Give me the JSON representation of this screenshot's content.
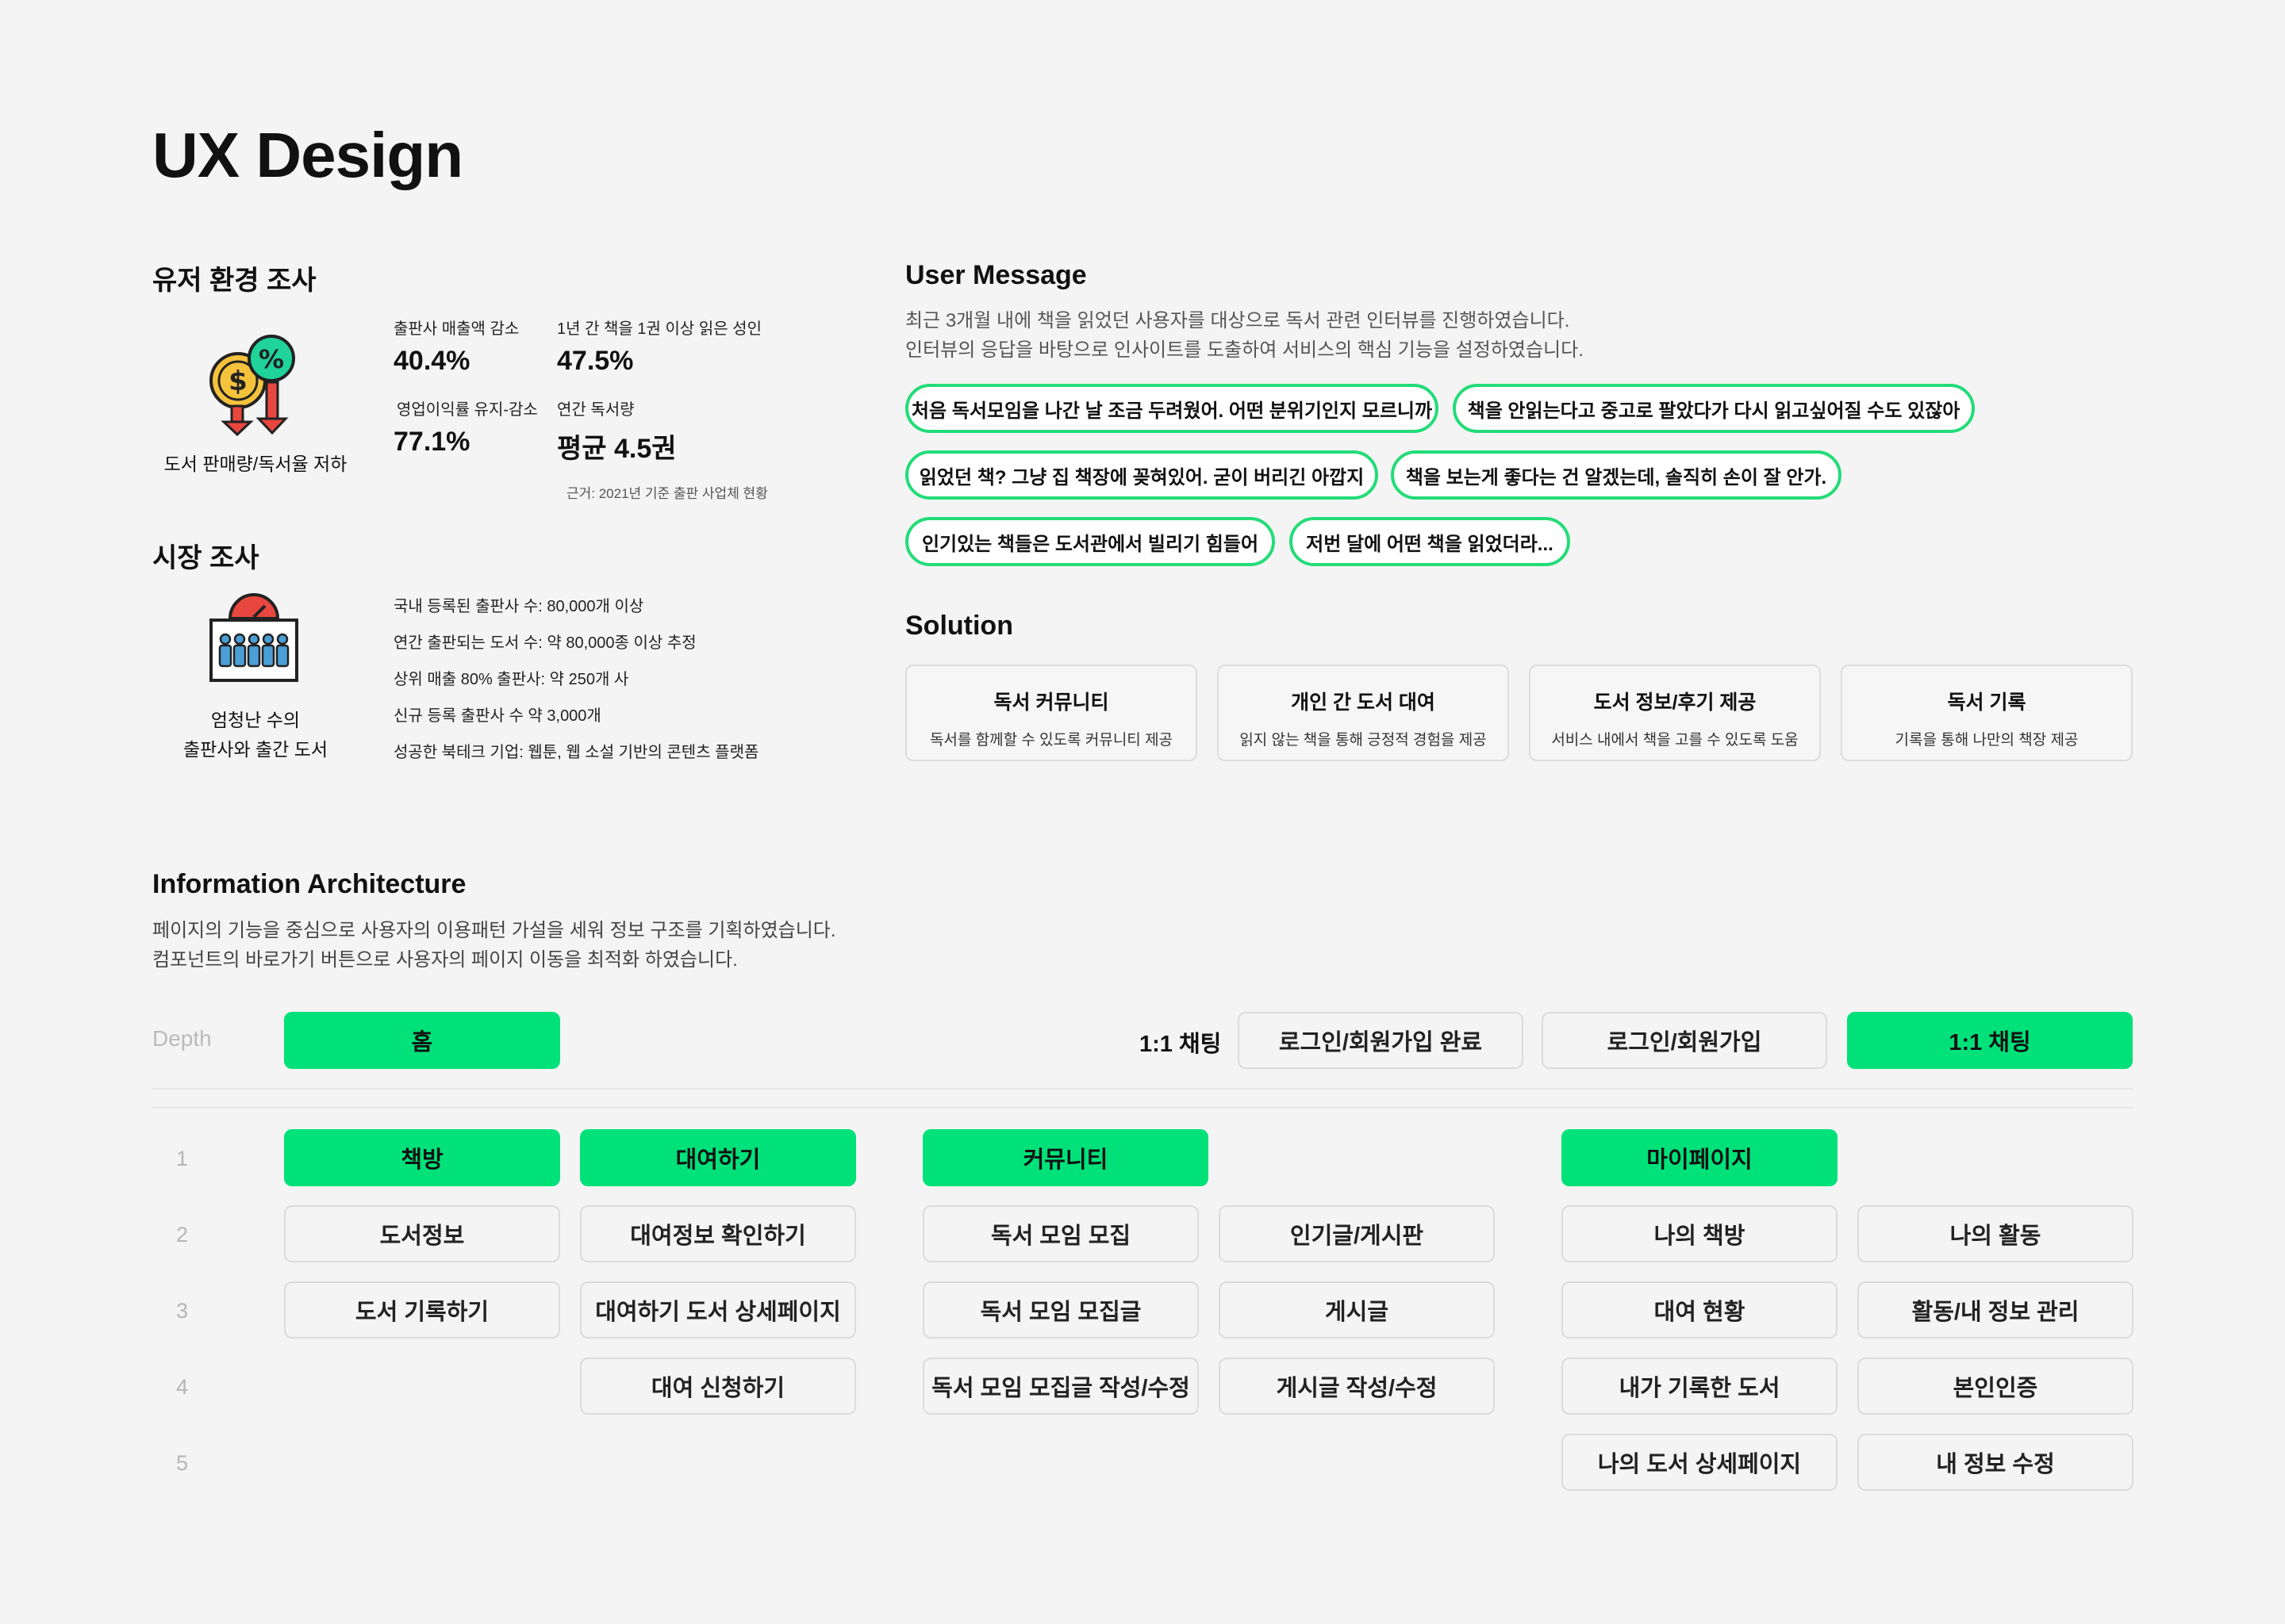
{
  "title": "UX Design",
  "user_env": {
    "heading": "유저 환경 조사",
    "icon_caption": "도서 판매량/독서율 저하",
    "stats": [
      {
        "label": "출판사 매출액 감소",
        "value": "40.4%"
      },
      {
        "label": "1년 간 책을 1권 이상 읽은 성인",
        "value": "47.5%"
      },
      {
        "label": "영업이익률 유지-감소",
        "value": "77.1%"
      },
      {
        "label": "연간 독서량",
        "value": "평균 4.5권"
      }
    ],
    "source": "근거: 2021년 기준 출판 사업체 현황"
  },
  "market": {
    "heading": "시장 조사",
    "icon_caption_line1": "엄청난 수의",
    "icon_caption_line2": "출판사와 출간 도서",
    "facts": [
      "국내 등록된 출판사 수: 80,000개 이상",
      "연간 출판되는 도서 수: 약 80,000종 이상 추정",
      "상위 매출 80% 출판사: 약 250개 사",
      "신규 등록 출판사 수 약 3,000개",
      "성공한 북테크 기업: 웹툰, 웹 소설 기반의 콘텐츠 플랫폼"
    ]
  },
  "user_message": {
    "heading": "User Message",
    "desc1": "최근 3개월 내에 책을 읽었던 사용자를 대상으로 독서 관련 인터뷰를 진행하였습니다.",
    "desc2": "인터뷰의 응답을 바탕으로 인사이트를 도출하여 서비스의 핵심 기능을 설정하였습니다.",
    "quotes": [
      "처음 독서모임을 나간 날 조금 두려웠어. 어떤 분위기인지 모르니까",
      "책을 안읽는다고 중고로 팔았다가 다시 읽고싶어질 수도 있잖아",
      "읽었던 책? 그냥 집 책장에 꽂혀있어. 굳이 버리긴 아깝지",
      "책을 보는게 좋다는 건 알겠는데, 솔직히 손이 잘 안가.",
      "인기있는 책들은 도서관에서 빌리기 힘들어",
      "저번 달에 어떤 책을 읽었더라..."
    ]
  },
  "solution": {
    "heading": "Solution",
    "items": [
      {
        "title": "독서 커뮤니티",
        "desc": "독서를 함께할 수 있도록 커뮤니티 제공"
      },
      {
        "title": "개인 간 도서 대여",
        "desc": "읽지 않는 책을 통해 긍정적 경험을 제공"
      },
      {
        "title": "도서 정보/후기 제공",
        "desc": "서비스 내에서 책을 고를 수 있도록 도움"
      },
      {
        "title": "독서 기록",
        "desc": "기록을 통해 나만의 책장 제공"
      }
    ]
  },
  "ia": {
    "heading": "Information Architecture",
    "desc1": "페이지의 기능을 중심으로 사용자의 이용패턴 가설을 세워 정보 구조를 기획하였습니다.",
    "desc2": "컴포넌트의 바로가기 버튼으로 사용자의 페이지 이동을 최적화 하였습니다.",
    "depth_label": "Depth",
    "home": "홈",
    "chat_label": "1:1 채팅",
    "login_done": "로그인/회원가입 완료",
    "login": "로그인/회원가입",
    "chat": "1:1 채팅",
    "row_numbers": [
      "1",
      "2",
      "3",
      "4",
      "5"
    ],
    "bookroom": [
      "책방",
      "도서정보",
      "도서 기록하기"
    ],
    "rental": [
      "대여하기",
      "대여정보 확인하기",
      "대여하기 도서 상세페이지",
      "대여 신청하기"
    ],
    "community": {
      "title": "커뮤니티",
      "col1": [
        "독서 모임 모집",
        "독서 모임 모집글",
        "독서 모임 모집글 작성/수정"
      ],
      "col2": [
        "인기글/게시판",
        "게시글",
        "게시글 작성/수정"
      ]
    },
    "mypage": {
      "title": "마이페이지",
      "col1": [
        "나의 책방",
        "대여 현황",
        "내가 기록한 도서",
        "나의 도서 상세페이지"
      ],
      "col2": [
        "나의 활동",
        "활동/내 정보 관리",
        "본인인증",
        "내 정보 수정"
      ]
    }
  },
  "colors": {
    "accent": "#00e17a",
    "accent_border": "#22dc78",
    "icon_red": "#e8473f",
    "icon_yellow": "#f5c23c",
    "icon_teal": "#1fb59a",
    "icon_blue": "#4b9fd6"
  }
}
